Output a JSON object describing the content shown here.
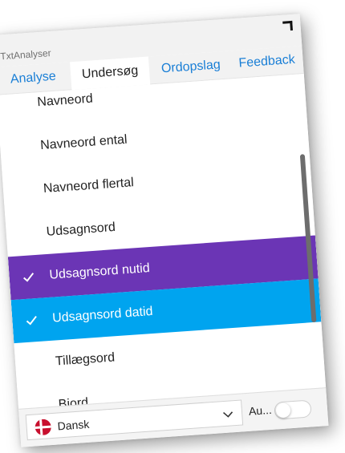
{
  "app": {
    "title": "TxtAnalyser"
  },
  "tabs": [
    {
      "label": "Analyse",
      "active": false
    },
    {
      "label": "Undersøg",
      "active": true
    },
    {
      "label": "Ordopslag",
      "active": false
    },
    {
      "label": "Feedback",
      "active": false
    }
  ],
  "list": {
    "items": [
      {
        "label": "Navneord",
        "checked": false
      },
      {
        "label": "Navneord ental",
        "checked": false
      },
      {
        "label": "Navneord flertal",
        "checked": false
      },
      {
        "label": "Udsagnsord",
        "checked": false
      },
      {
        "label": "Udsagnsord nutid",
        "checked": true,
        "highlight": "#6b35b5"
      },
      {
        "label": "Udsagnsord datid",
        "checked": true,
        "highlight": "#00a4ef"
      },
      {
        "label": "Tillægsord",
        "checked": false
      },
      {
        "label": "Biord",
        "checked": false
      }
    ]
  },
  "footer": {
    "language": "Dansk",
    "auto_label": "Au...",
    "auto_enabled": false
  },
  "colors": {
    "accent_link": "#1a7fd6",
    "selected_purple": "#6b35b5",
    "selected_blue": "#00a4ef",
    "flag_red": "#c8102e"
  },
  "icons": {
    "check": "checkmark-icon",
    "corner": "corner-bracket-icon",
    "chevron": "chevron-down-icon",
    "flag": "denmark-flag-icon"
  }
}
